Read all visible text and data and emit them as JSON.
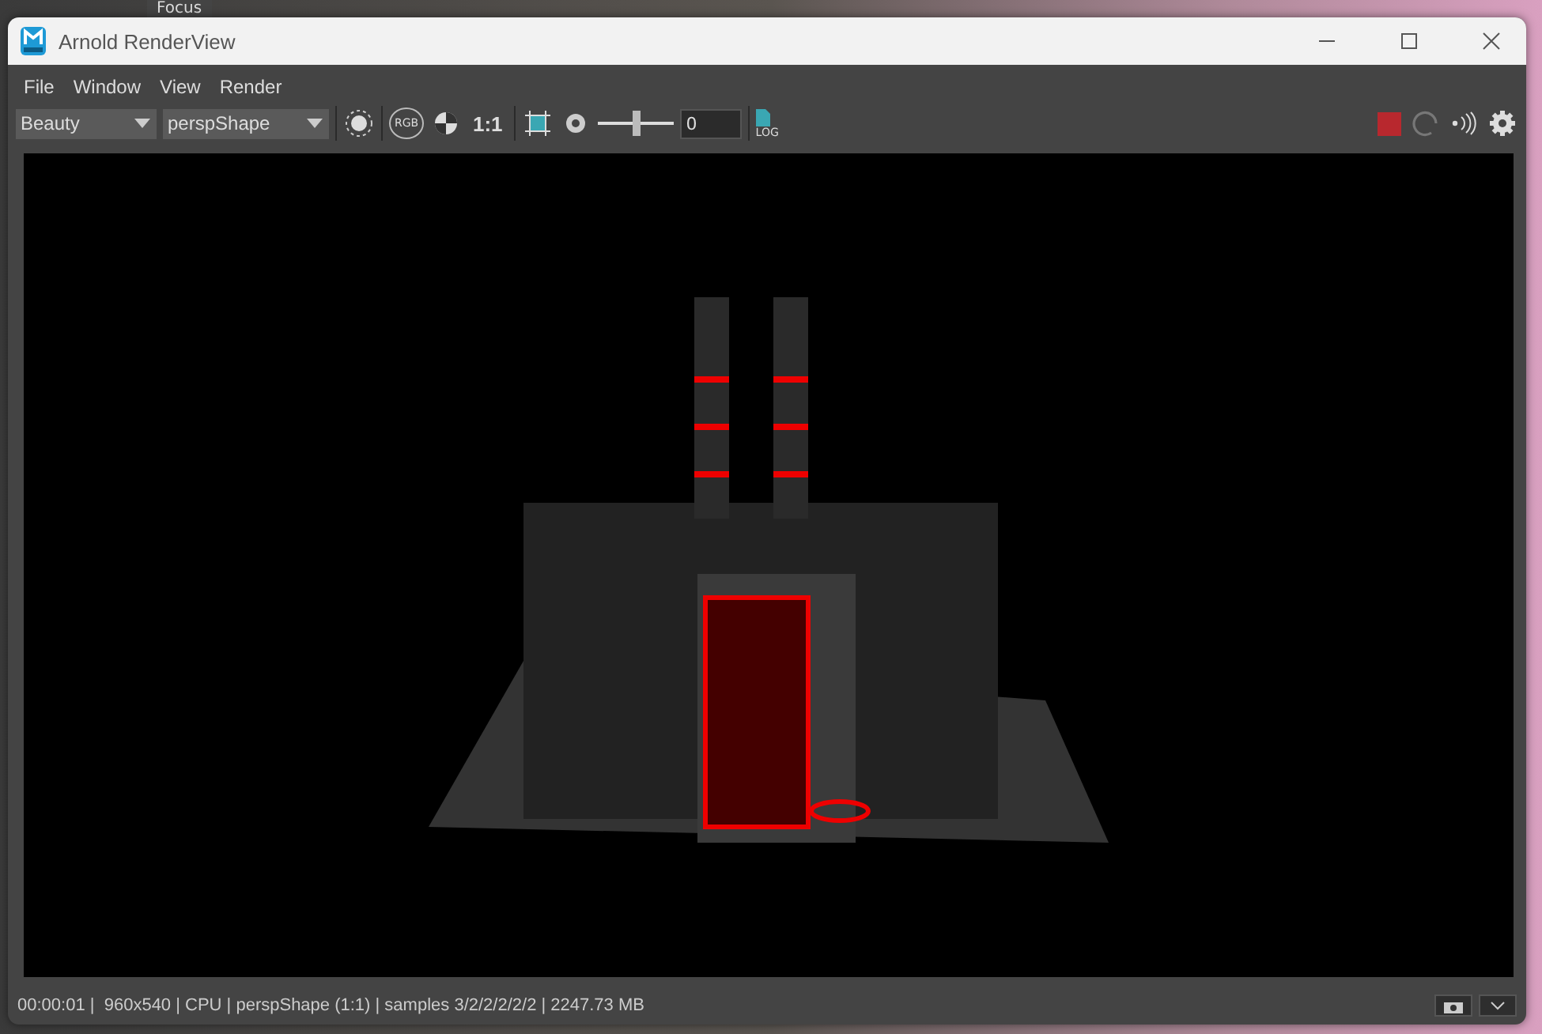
{
  "backdrop": {
    "label": "Focus"
  },
  "window": {
    "title": "Arnold RenderView"
  },
  "menu": [
    "File",
    "Window",
    "View",
    "Render"
  ],
  "toolbar": {
    "aov": "Beauty",
    "camera": "perspShape",
    "rgb_label": "RGB",
    "zoom": "1:1",
    "exposure": {
      "level": 0.5,
      "value": "0"
    },
    "log_label": "LOG"
  },
  "status_bar": {
    "text": "00:00:01 |  960x540 | CPU | perspShape (1:1) | samples 3/2/2/2/2/2 | 2247.73 MB"
  }
}
